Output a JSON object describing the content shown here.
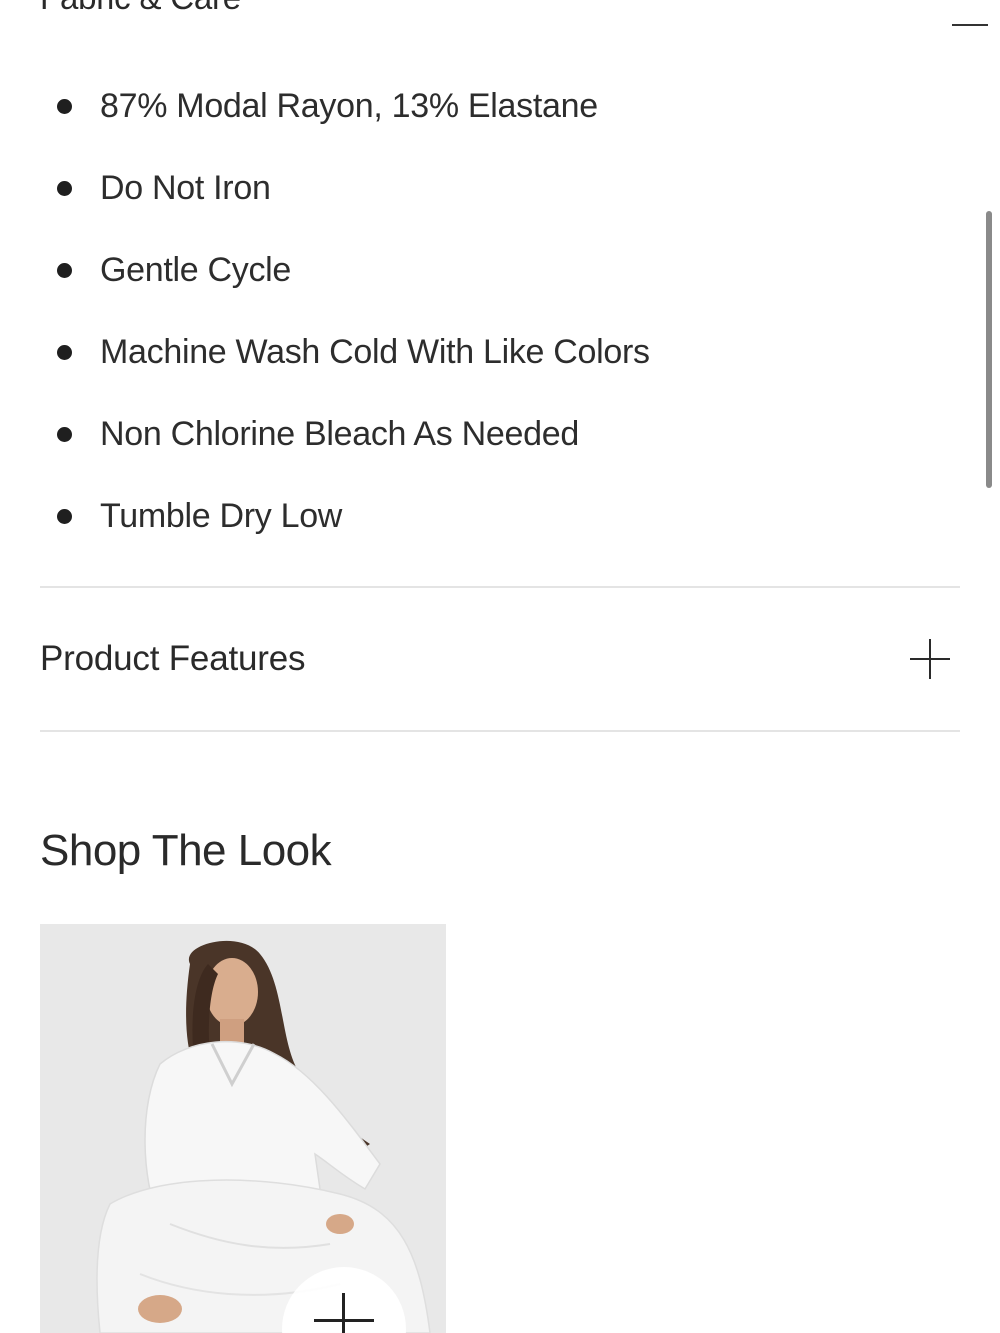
{
  "fabric_care": {
    "title": "Fabric & Care",
    "items": [
      "87% Modal Rayon, 13% Elastane",
      "Do Not Iron",
      "Gentle Cycle",
      "Machine Wash Cold With Like Colors",
      "Non Chlorine Bleach As Needed",
      "Tumble Dry Low"
    ]
  },
  "product_features": {
    "label": "Product Features"
  },
  "shop_the_look": {
    "title": "Shop The Look"
  },
  "icons": {
    "collapse": "minus-icon",
    "expand": "plus-icon",
    "add": "plus-icon"
  }
}
